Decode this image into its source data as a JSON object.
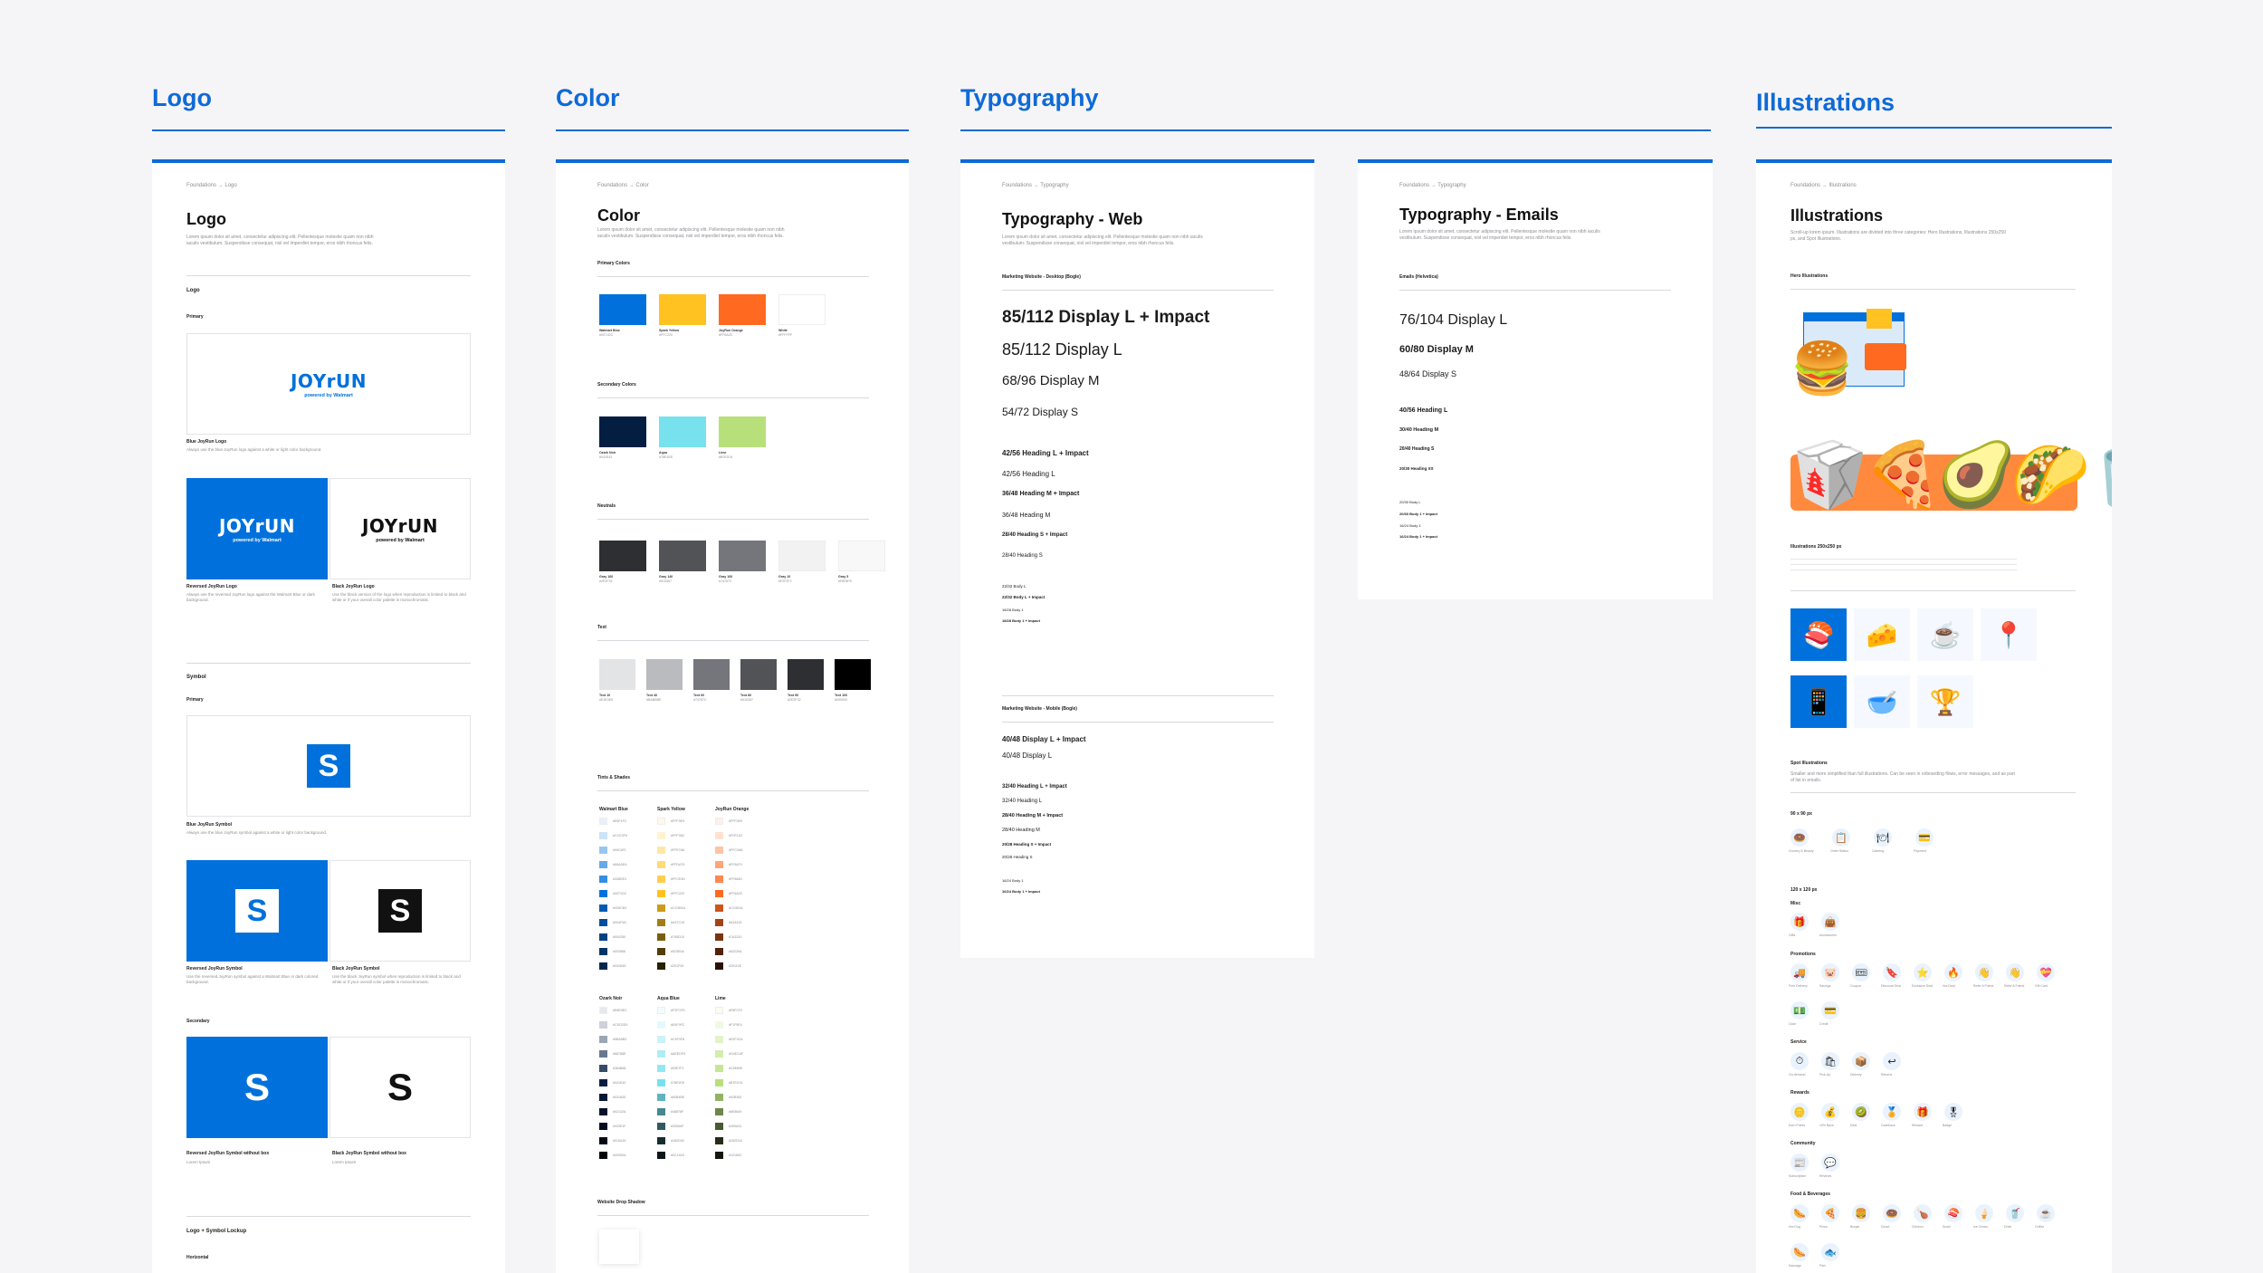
{
  "columns": {
    "logo": "Logo",
    "color": "Color",
    "typography": "Typography",
    "illustrations": "Illustrations"
  },
  "logo_card": {
    "breadcrumb": "Foundations → Logo",
    "title": "Logo",
    "description": "Lorem ipsum dolor sit amet, consectetur adipiscing elit. Pellentesque molestie quam non nibh iaculis vestibulum. Suspendisse consequat, nisl vel imperdiet tempor, eros nibh rhoncus felis.",
    "section_logo": "Logo",
    "primary": "Primary",
    "wordmark": "JOYrUN",
    "powered_by": "powered by Walmart",
    "blue_logo_caption": "Blue JoyRun Logo",
    "blue_logo_desc": "Always use the blue JoyRun logo against a white or light color background.",
    "reversed_logo_caption": "Reversed JoyRun Logo",
    "reversed_logo_desc": "Always use the reversed JoyRun logo against the Walmart Blue or dark background.",
    "black_logo_caption": "Black JoyRun Logo",
    "black_logo_desc": "Use the black version of the logo when reproduction is limited to black and white or if your overall color palette is monochromatic.",
    "section_symbol": "Symbol",
    "symbol_primary": "Primary",
    "symbol_glyph": "S",
    "blue_symbol_caption": "Blue JoyRun Symbol",
    "blue_symbol_desc": "Always use the blue JoyRun symbol against a white or light color background.",
    "reversed_symbol_caption": "Reversed JoyRun Symbol",
    "reversed_symbol_desc": "Use the reversed JoyRun symbol against a Walmart Blue or dark colored background.",
    "black_symbol_caption": "Black JoyRun Symbol",
    "black_symbol_desc": "Use the black JoyRun symbol when reproduction is limited to black and white or if your overall color palette is monochromatic.",
    "secondary": "Secondary",
    "reversed_nobox_caption": "Reversed JoyRun Symbol without box",
    "reversed_nobox_desc": "Lorem Ipsum",
    "black_nobox_caption": "Black JoyRun Symbol without box",
    "black_nobox_desc": "Lorem Ipsum",
    "lockup": "Logo + Symbol Lockup",
    "horizontal": "Horizontal"
  },
  "color_card": {
    "breadcrumb": "Foundations → Color",
    "title": "Color",
    "description": "Lorem ipsum dolor sit amet, consectetur adipiscing elit. Pellentesque molestie quam non nibh iaculis vestibulum. Suspendisse consequat, nisl vel imperdiet tempor, eros nibh rhoncus felis.",
    "primary_colors": "Primary Colors",
    "primary_swatches": [
      {
        "name": "Walmart Blue",
        "hex": "#0071DC"
      },
      {
        "name": "Spark Yellow",
        "hex": "#FFC220"
      },
      {
        "name": "JoyRun Orange",
        "hex": "#FF6A20"
      },
      {
        "name": "White",
        "hex": "#FFFFFF"
      }
    ],
    "secondary_colors": "Secondary Colors",
    "secondary_swatches": [
      {
        "name": "Ozark Noir",
        "hex": "#041E42"
      },
      {
        "name": "Aqua",
        "hex": "#78E1EE"
      },
      {
        "name": "Lime",
        "hex": "#B7E07A"
      }
    ],
    "neutrals": "Neutrals",
    "neutral_swatches": [
      {
        "name": "Gray 160",
        "hex": "#2E2F32"
      },
      {
        "name": "Gray 140",
        "hex": "#515357"
      },
      {
        "name": "Gray 100",
        "hex": "#74767C"
      },
      {
        "name": "Gray 10",
        "hex": "#F2F2F2"
      },
      {
        "name": "Gray 5",
        "hex": "#F8F8F8"
      }
    ],
    "text": "Text",
    "text_swatches": [
      {
        "name": "Text 10",
        "hex": "#E3E4E5"
      },
      {
        "name": "Text 40",
        "hex": "#BABBBE"
      },
      {
        "name": "Text 60",
        "hex": "#74767C"
      },
      {
        "name": "Text 80",
        "hex": "#515357"
      },
      {
        "name": "Text 90",
        "hex": "#2E2F32"
      },
      {
        "name": "Text 100",
        "hex": "#000000"
      }
    ],
    "tints_shades": "Tints & Shades",
    "tints_groups": [
      {
        "name": "Walmart Blue",
        "colors": [
          "#E6F1FC",
          "#CCE3F8",
          "#99C6F1",
          "#66AAEA",
          "#338DE3",
          "#0071DC",
          "#005CB3",
          "#004F9A",
          "#004280",
          "#003566",
          "#00284D"
        ]
      },
      {
        "name": "Spark Yellow",
        "colors": [
          "#FFF9E9",
          "#FFF3D2",
          "#FFE7A6",
          "#FFDA79",
          "#FFCE4D",
          "#FFC220",
          "#CC9B1A",
          "#A37C15",
          "#7A5D10",
          "#523E0A",
          "#291F05"
        ]
      },
      {
        "name": "JoyRun Orange",
        "colors": [
          "#FFF0E9",
          "#FFE1D2",
          "#FFC3A6",
          "#FFA679",
          "#FF884D",
          "#FF6A20",
          "#CC551A",
          "#A34415",
          "#7A3310",
          "#52220A",
          "#291105"
        ]
      },
      {
        "name": "Ozark Noir",
        "colors": [
          "#E6E9EC",
          "#CDD2D9",
          "#9BA5B3",
          "#68788E",
          "#364B68",
          "#041E42",
          "#031835",
          "#02132A",
          "#020E1F",
          "#010A15",
          "#00050A"
        ]
      },
      {
        "name": "Aqua Blue",
        "colors": [
          "#F2FCFD",
          "#E4F9FC",
          "#C9F3F8",
          "#AEEDF5",
          "#93E7F1",
          "#78E1EE",
          "#60B4BE",
          "#48878F",
          "#305A5F",
          "#182D30",
          "#0C1618"
        ]
      },
      {
        "name": "Lime",
        "colors": [
          "#F8FCF2",
          "#F1F9E4",
          "#E2F3CA",
          "#D4ECAF",
          "#C5E695",
          "#B7E07A",
          "#92B362",
          "#6E8649",
          "#495A31",
          "#252D18",
          "#12160C"
        ]
      }
    ],
    "drop_shadow": "Website Drop Shadow"
  },
  "typo_web": {
    "breadcrumb": "Foundations → Typography",
    "title": "Typography - Web",
    "description": "Lorem ipsum dolor sit amet, consectetur adipiscing elit. Pellentesque molestie quam non nibh iaculis vestibulum. Suspendisse consequat, nisl vel imperdiet tempor, eros nibh rhoncus felis.",
    "desktop_label": "Marketing Website - Desktop (Bogle)",
    "desktop_samples": [
      "85/112 Display L + Impact",
      "85/112 Display L",
      "68/96 Display M",
      "54/72 Display S",
      "42/56 Heading L + Impact",
      "42/56 Heading L",
      "36/48 Heading M + Impact",
      "36/48 Heading M",
      "28/40 Heading S + Impact",
      "28/40 Heading S",
      "22/32 Body L",
      "22/32 Body L + Impact",
      "18/28 Body 1",
      "18/28 Body 1 + Impact"
    ],
    "mobile_label": "Marketing Website - Mobile (Bogle)",
    "mobile_samples": [
      "40/48 Display L + Impact",
      "40/48 Display L",
      "32/40 Heading L + Impact",
      "32/40 Heading L",
      "28/40 Heading M + Impact",
      "28/40 Heading M",
      "20/28 Heading S + Impact",
      "20/28 Heading S",
      "16/24 Body 1",
      "16/24 Body 1 + Impact"
    ]
  },
  "typo_email": {
    "breadcrumb": "Foundations → Typography",
    "title": "Typography - Emails",
    "description": "Lorem ipsum dolor sit amet, consectetur adipiscing elit. Pellentesque molestie quam non nibh iaculis vestibulum. Suspendisse consequat, nisl vel imperdiet tempor, eros nibh rhoncus felis.",
    "label": "Emails (Helvetica)",
    "samples": [
      "76/104 Display L",
      "60/80 Display M",
      "48/64 Display S",
      "40/56 Heading L",
      "30/40 Heading M",
      "20/40 Heading S",
      "20/30 Heading XS",
      "20/30 Body L",
      "20/30 Body 1 + Impact",
      "16/24 Body 1",
      "16/24 Body 1 + Impact"
    ]
  },
  "ill_card": {
    "breadcrumb": "Foundations → Illustrations",
    "title": "Illustrations",
    "description": "Scroll-up lorem ipsum. Illustrations are divided into three categories: Hero Illustrations, Illustrations 250x250 px, and Spot Illustrations.",
    "hero": "Hero Illustrations",
    "tiles_label": "Illustrations 250x250 px",
    "spot": "Spot Illustrations",
    "spot_desc": "Smaller and more simplified than full illustrations. Can be seen in onboarding flows, error messages, and as part of list in emails.",
    "row1_label": "90 x 90 px",
    "row1": [
      "Grocery & Beauty",
      "Order Status",
      "Catering",
      "Payment"
    ],
    "row2_label": "120 x 120 px",
    "misc": "Misc",
    "misc_items": [
      "Gifts",
      "Accessories"
    ],
    "promotions": "Promotions",
    "promo_items": [
      "Free Delivery",
      "Savings",
      "Coupon",
      "Discount Deal",
      "Exclusive Deal",
      "Hot Deal",
      "Refer A Friend",
      "Refer A Friend",
      "Gift Card"
    ],
    "promo_items_2": [
      "Cash",
      "Credit"
    ],
    "service": "Service",
    "service_items": [
      "On-demand",
      "Pick-Up",
      "Delivery",
      "Returns"
    ],
    "rewards": "Rewards",
    "reward_items": [
      "Earn Points",
      "10% Back",
      "Deal",
      "Cashback",
      "Reward",
      "Badge"
    ],
    "community": "Community",
    "community_items": [
      "Subscription",
      "Reviews"
    ],
    "food": "Food & Beverages",
    "food_items": [
      "Hot Dog",
      "Pizza",
      "Burger",
      "Donut",
      "Chicken",
      "Sushi",
      "Ice Cream",
      "Drink",
      "Coffee"
    ],
    "food_items_2": [
      "Sausage",
      "Fish"
    ]
  },
  "colors": {
    "accent": "#0F6AD6",
    "walmart_blue": "#0071DC",
    "black": "#111111"
  }
}
